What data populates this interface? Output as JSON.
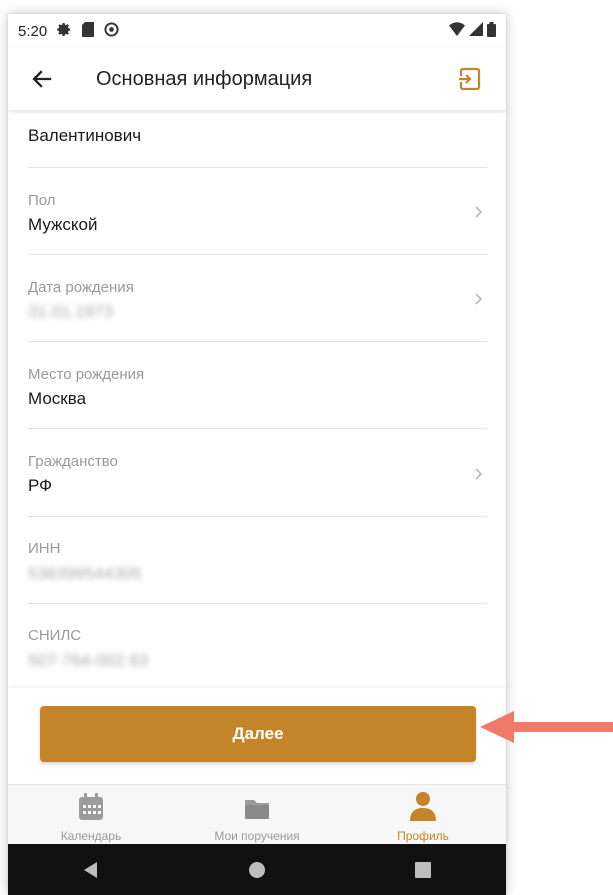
{
  "status_bar": {
    "time": "5:20"
  },
  "app_bar": {
    "title": "Основная информация"
  },
  "fields": [
    {
      "label": "",
      "value": "Валентинович"
    },
    {
      "label": "Пол",
      "value": "Мужской"
    },
    {
      "label": "Дата рождения",
      "value": "31.01.1973"
    },
    {
      "label": "Место рождения",
      "value": "Москва"
    },
    {
      "label": "Гражданство",
      "value": "РФ"
    },
    {
      "label": "ИНН",
      "value": "536399544305"
    },
    {
      "label": "СНИЛС",
      "value": "507-764-002 83"
    }
  ],
  "next_button": {
    "label": "Далее"
  },
  "bottom_nav": [
    {
      "label": "Календарь",
      "icon": "calendar-icon"
    },
    {
      "label": "Мои поручения",
      "icon": "folder-icon"
    },
    {
      "label": "Профиль",
      "icon": "person-icon"
    }
  ],
  "colors": {
    "accent": "#c48429",
    "arrow": "#f07a6a"
  }
}
